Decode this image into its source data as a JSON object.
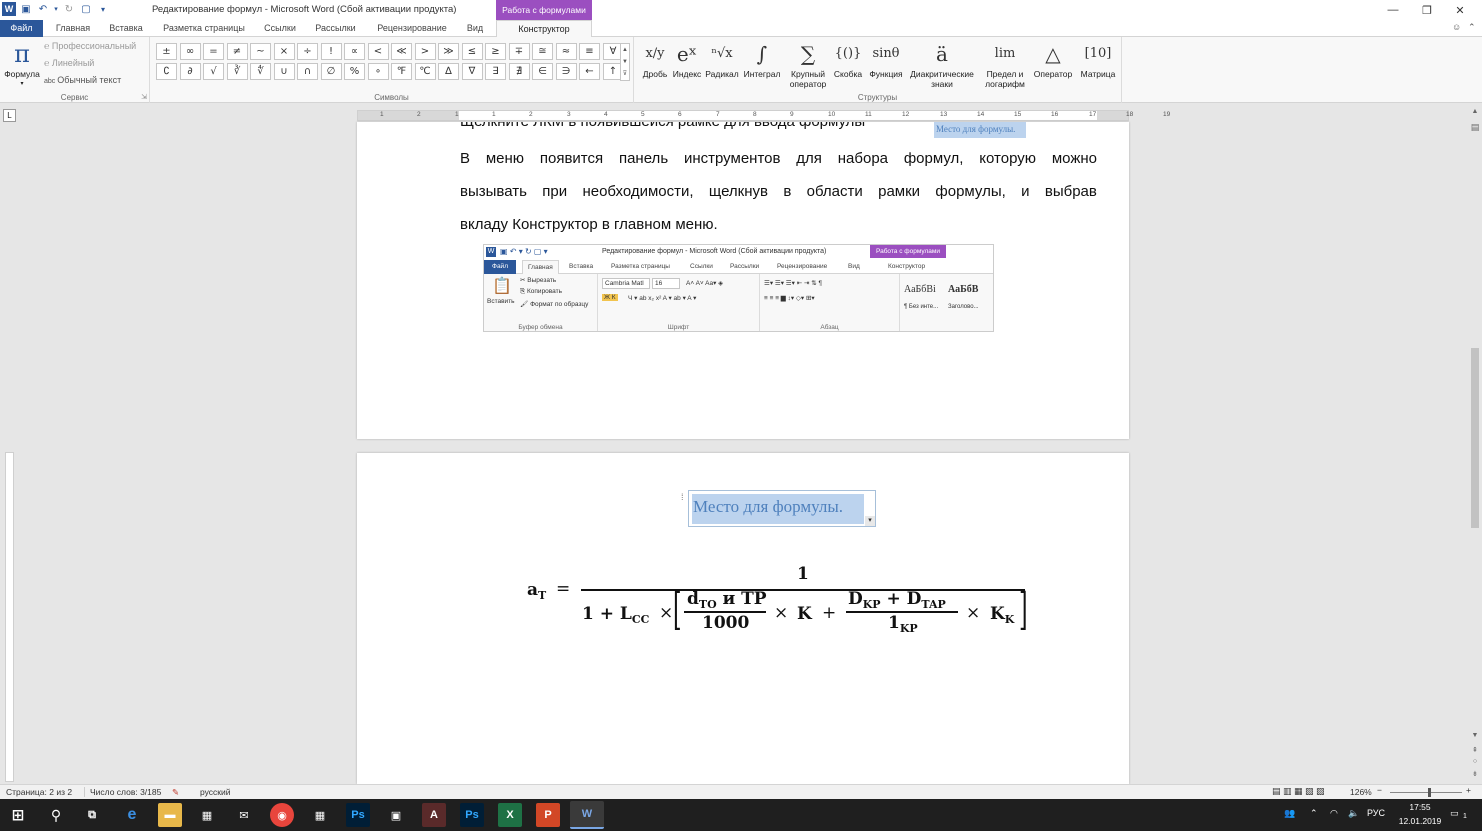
{
  "window": {
    "title": "Редактирование формул  -  Microsoft Word (Сбой активации продукта)",
    "context_header": "Работа с формулами",
    "controls": [
      "—",
      "❐",
      "✕"
    ]
  },
  "tabs": [
    "Файл",
    "Главная",
    "Вставка",
    "Разметка страницы",
    "Ссылки",
    "Рассылки",
    "Рецензирование",
    "Вид",
    "Конструктор"
  ],
  "ribbon": {
    "service": {
      "formula_label": "Формула",
      "options": [
        "Профессиональный",
        "Линейный",
        "Обычный текст"
      ],
      "label": "Сервис"
    },
    "symbols": {
      "row1": [
        "±",
        "∞",
        "=",
        "≠",
        "~",
        "×",
        "÷",
        "!",
        "∝",
        "<",
        "≪",
        ">",
        "≫",
        "≤",
        "≥",
        "∓",
        "≅",
        "≈",
        "≡",
        "∀"
      ],
      "row2": [
        "∁",
        "∂",
        "√",
        "∛",
        "∜",
        "∪",
        "∩",
        "∅",
        "%",
        "∘",
        "℉",
        "℃",
        "∆",
        "∇",
        "∃",
        "∄",
        "∈",
        "∋",
        "←",
        "↑"
      ],
      "label": "Символы"
    },
    "structures": {
      "items": [
        {
          "glyph": "x/y",
          "label": "Дробь"
        },
        {
          "glyph": "eˣ",
          "label": "Индекс"
        },
        {
          "glyph": "ⁿ√x",
          "label": "Радикал"
        },
        {
          "glyph": "∫",
          "label": "Интеграл"
        },
        {
          "glyph": "∑",
          "label": "Крупный оператор"
        },
        {
          "glyph": "{()}",
          "label": "Скобка"
        },
        {
          "glyph": "sinθ",
          "label": "Функция"
        },
        {
          "glyph": "ä",
          "label": "Диакритические знаки"
        },
        {
          "glyph": "lim",
          "label": "Предел и логарифм"
        },
        {
          "glyph": "△",
          "label": "Оператор"
        },
        {
          "glyph": "[10]",
          "label": "Матрица"
        }
      ],
      "label": "Структуры"
    }
  },
  "ruler": {
    "numbers": [
      "1",
      "2",
      "1",
      "1",
      "2",
      "3",
      "4",
      "5",
      "6",
      "7",
      "8",
      "9",
      "10",
      "11",
      "12",
      "13",
      "14",
      "15",
      "16",
      "17",
      "18",
      "19"
    ],
    "corner": "L"
  },
  "page1": {
    "cut_line": "Щелкните ЛКМ в появившейся рамке для ввода формулы",
    "placeholder_small": "Место для формулы.",
    "line1": [
      "В",
      "меню",
      "появится",
      "панель",
      "инструментов",
      "для",
      "набора",
      "формул,",
      "которую",
      "можно"
    ],
    "line2": [
      "вызывать",
      "при",
      "необходимости,",
      "щелкнув",
      "в",
      "области",
      "рамки",
      "формулы,",
      "и",
      "выбрав"
    ],
    "line3": "вкладу Конструктор в главном меню."
  },
  "mini_screenshot": {
    "title": "Редактирование формул  -  Microsoft Word (Сбой активации продукта)",
    "context_header": "Работа с формулами",
    "tabs": [
      "Файл",
      "Главная",
      "Вставка",
      "Разметка страницы",
      "Ссылки",
      "Рассылки",
      "Рецензирование",
      "Вид",
      "Конструктор"
    ],
    "clipboard": {
      "paste": "Вставить",
      "cut": "Вырезать",
      "copy": "Копировать",
      "format": "Формат по образцу",
      "label": "Буфер обмена"
    },
    "font": {
      "name": "Cambria Matl",
      "size": "16",
      "label": "Шрифт"
    },
    "paragraph": {
      "label": "Абзац"
    },
    "styles": {
      "sample1": "АаБбВі",
      "sample2": "АаБбВ",
      "name1": "¶ Без инте...",
      "name2": "Заголово..."
    }
  },
  "page2": {
    "placeholder": "Место для формулы.",
    "formula": {
      "lhs": "a",
      "lhs_sub": "T",
      "eq": "=",
      "numerator": "1",
      "den_start": "1 +  L",
      "L_sub": "CC",
      "times": "×",
      "inner_num": "d",
      "inner_num_sub": "TO",
      "inner_num_rest": " и TP",
      "inner_den": "1000",
      "K": "K",
      "plus": "+",
      "D1": "D",
      "D1_sub": "KP",
      "D2": "+  D",
      "D2_sub": "TAP",
      "frac2_den": "1",
      "frac2_den_sub": "KP",
      "KK": "K",
      "KK_sub": "K"
    }
  },
  "status": {
    "page": "Страница: 2 из 2",
    "words": "Число слов: 3/185",
    "lang": "русский",
    "zoom": "126%"
  },
  "taskbar": {
    "lang": "РУС",
    "time": "17:55",
    "date": "12.01.2019",
    "notif": "1"
  }
}
